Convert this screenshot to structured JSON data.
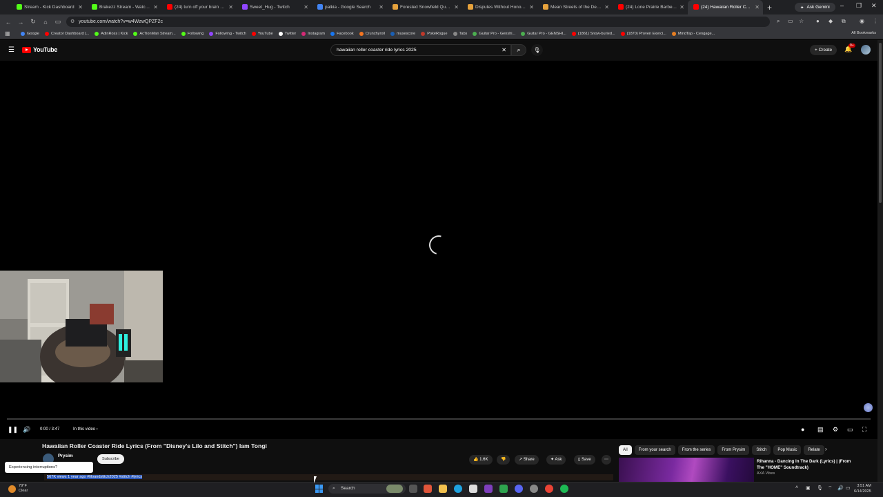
{
  "browser": {
    "tabs": [
      {
        "title": "Stream - Kick Dashboard",
        "color": "#53fc18"
      },
      {
        "title": "Brakezz Stream - Watch Live",
        "color": "#53fc18"
      },
      {
        "title": "(24) turn off your brain for a",
        "color": "#ff0000"
      },
      {
        "title": "Sweet_Hug - Twitch",
        "color": "#9146ff"
      },
      {
        "title": "palkia - Google Search",
        "color": "#4285f4"
      },
      {
        "title": "Forested Snowfield Quest C",
        "color": "#e6a23c"
      },
      {
        "title": "Disputes Without Honor an",
        "color": "#e6a23c"
      },
      {
        "title": "Mean Streets of the Despic",
        "color": "#e6a23c"
      },
      {
        "title": "(24) Lone Prairie Barbershop",
        "color": "#ff0000"
      },
      {
        "title": "(24) Hawaiian Roller Coaster",
        "color": "#ff0000",
        "active": true
      }
    ],
    "ask_gemini": "Ask Gemini",
    "url": "youtube.com/watch?v=w4WzwQPZF2c",
    "bookmarks": [
      {
        "label": "Google",
        "color": "#4285f4"
      },
      {
        "label": "Creator Dashboard |...",
        "color": "#ff0000"
      },
      {
        "label": "AdinRoss | Kick",
        "color": "#53fc18"
      },
      {
        "label": "AcTionMan Stream...",
        "color": "#53fc18"
      },
      {
        "label": "Following",
        "color": "#53fc18"
      },
      {
        "label": "Following - Twitch",
        "color": "#9146ff"
      },
      {
        "label": "YouTube",
        "color": "#ff0000"
      },
      {
        "label": "Twitter",
        "color": "#ffffff"
      },
      {
        "label": "Instagram",
        "color": "#d62976"
      },
      {
        "label": "Facebook",
        "color": "#1877f2"
      },
      {
        "label": "Crunchyroll",
        "color": "#f47521"
      },
      {
        "label": "musescore",
        "color": "#1a5fb4"
      },
      {
        "label": "PokéRogue",
        "color": "#c0392b"
      },
      {
        "label": "Tabs",
        "color": "#888888"
      },
      {
        "label": "Guitar Pro - Genshi...",
        "color": "#4caf50"
      },
      {
        "label": "Guitar Pro - GENSHI...",
        "color": "#4caf50"
      },
      {
        "label": "(1861) Snow-buried...",
        "color": "#ff0000"
      },
      {
        "label": "(1870) Proven Exerci...",
        "color": "#ff0000"
      },
      {
        "label": "MindTap - Cengage...",
        "color": "#e67e22"
      }
    ],
    "all_bookmarks": "All Bookmarks"
  },
  "youtube": {
    "logo": "YouTube",
    "search_query": "hawaiian roller coaster ride lyrics 2025",
    "create_label": "Create",
    "notif_badge": "9+",
    "player": {
      "time": "0:00 / 3:47",
      "in_this_video": "In this video"
    },
    "video": {
      "title": "Hawaiian Roller Coaster Ride Lyrics (From \"Disney's Lilo and Stitch\") Iam Tongi",
      "channel": "Prysim",
      "subscribe": "Subscribe",
      "likes": "1.6K",
      "share": "Share",
      "ask": "Ask",
      "save": "Save",
      "meta_text": "567K views  1 year ago  #liloandstitch2025 #stitch #lyrics",
      "toast": "Experiencing interruptions?"
    },
    "chips": [
      "All",
      "From your search",
      "From the series",
      "From Prysim",
      "Stitch",
      "Pop Music",
      "Relate"
    ],
    "recommendation": {
      "title": "Rihanna - Dancing In The Dark (Lyrics) | (From The \"HOME\" Soundtrack)",
      "channel": "AXA Vibes"
    }
  },
  "taskbar": {
    "weather_temp": "79°F",
    "weather_desc": "Clear",
    "search": "Search",
    "time": "3:51 AM",
    "date": "6/14/2025"
  }
}
